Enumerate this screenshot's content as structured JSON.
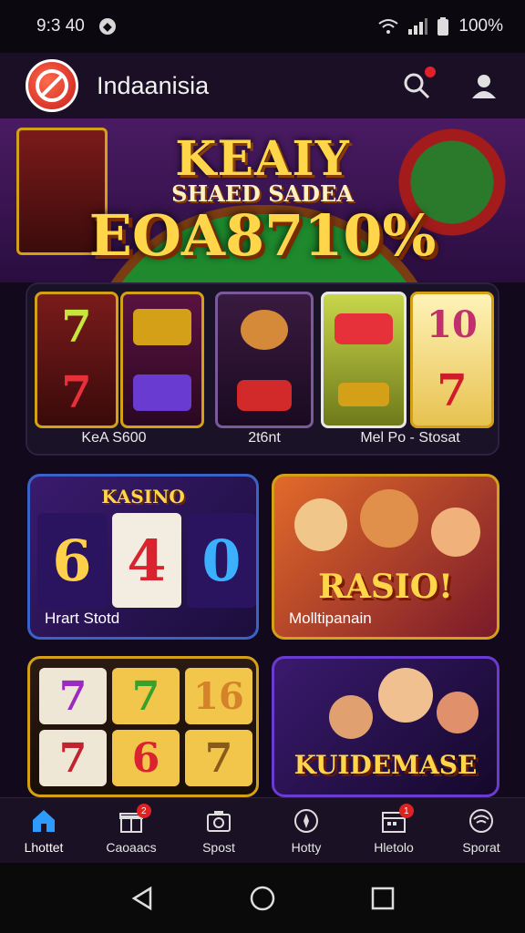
{
  "status_bar": {
    "time": "9:3 40",
    "battery": "100%"
  },
  "app_bar": {
    "title": "Indaanisia",
    "search_icon": "search-icon",
    "profile_icon": "user-icon"
  },
  "hero": {
    "title": "KEAIY",
    "subtitle": "SHAED SADEA",
    "amount": "EOA8710%"
  },
  "reels": {
    "labels": [
      "KeA S600",
      "2t6nt",
      "Mel Po - Stosat"
    ]
  },
  "tiles": {
    "kasino": {
      "heading": "KASINO",
      "caption": "Hrart Stotd",
      "symbols": [
        "6",
        "4",
        "0"
      ]
    },
    "raslo": {
      "heading": "RASIO!",
      "caption": "Molltipanain"
    },
    "sevens": {
      "symbols": [
        "7",
        "7",
        "16",
        "7",
        "6",
        "7"
      ]
    },
    "kuidemase": {
      "heading": "KUIDEMASE"
    }
  },
  "bottom_nav": {
    "items": [
      {
        "label": "Lhottet",
        "icon": "home-icon",
        "badge": ""
      },
      {
        "label": "Caoaacs",
        "icon": "gift-icon",
        "badge": "2"
      },
      {
        "label": "Spost",
        "icon": "camera-icon",
        "badge": ""
      },
      {
        "label": "Hotty",
        "icon": "compass-icon",
        "badge": ""
      },
      {
        "label": "Hletolo",
        "icon": "calendar-icon",
        "badge": "1"
      },
      {
        "label": "Sporat",
        "icon": "wifi-icon",
        "badge": ""
      }
    ]
  },
  "colors": {
    "accent_gold": "#d4a017",
    "accent_blue": "#2e9bff",
    "badge_red": "#d22222"
  }
}
